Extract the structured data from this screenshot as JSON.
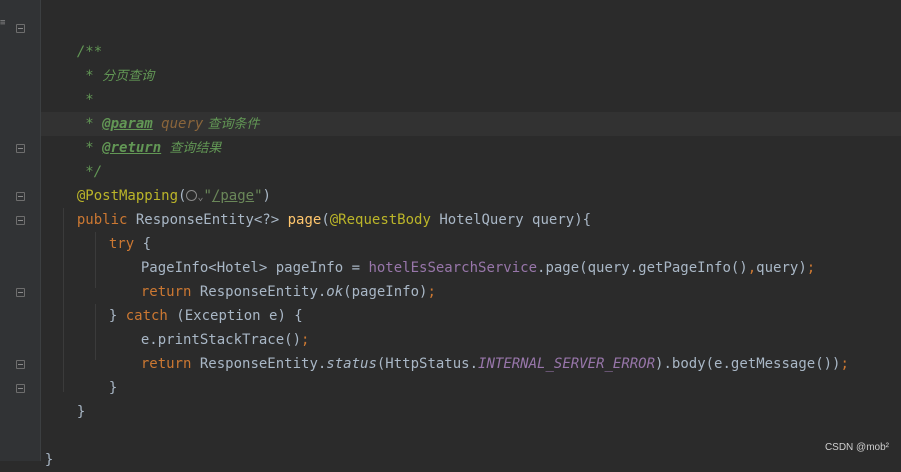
{
  "editor": {
    "lines": {
      "l1_open": "/**",
      "l2_star": " * ",
      "l2_text": "分页查询",
      "l3_star": " *",
      "l4_star": " * ",
      "l4_tag": "@param",
      "l4_space": " ",
      "l4_param": "query",
      "l4_text": " 查询条件",
      "l5_star": " * ",
      "l5_tag": "@return",
      "l5_text": "  查询结果",
      "l6_close": " */",
      "l7_anno": "@PostMapping",
      "l7_paren": "(",
      "l7_str_q1": "\"",
      "l7_str_path": "/page",
      "l7_str_q2": "\"",
      "l7_end": ")",
      "l8_public": "public",
      "l8_type": " ResponseEntity<?> ",
      "l8_method": "page",
      "l8_paren": "(",
      "l8_anno": "@RequestBody",
      "l8_params": " HotelQuery query){",
      "l9_try": "try",
      "l9_brace": " {",
      "l10_a": "PageInfo<Hotel> pageInfo = ",
      "l10_field": "hotelEsSearchService",
      "l10_b": ".page(query.getPageInfo()",
      "l10_comma": ",",
      "l10_c": "query)",
      "l10_semi": ";",
      "l11_return": "return",
      "l11_a": " ResponseEntity.",
      "l11_ok": "ok",
      "l11_b": "(pageInfo)",
      "l11_semi": ";",
      "l12_brace": "} ",
      "l12_catch": "catch",
      "l12_rest": " (Exception e) {",
      "l13_a": "e.printStackTrace()",
      "l13_semi": ";",
      "l14_return": "return",
      "l14_a": " ResponseEntity.",
      "l14_status": "status",
      "l14_b": "(HttpStatus.",
      "l14_const": "INTERNAL_SERVER_ERROR",
      "l14_c": ").body(e.getMessage())",
      "l14_semi": ";",
      "l15_brace": "}",
      "l16_brace": "}",
      "l18_brace": "}"
    }
  },
  "watermark": "CSDN @mob²"
}
